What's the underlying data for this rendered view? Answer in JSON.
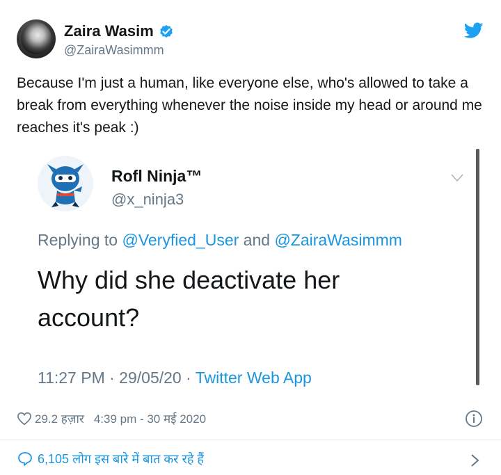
{
  "tweet": {
    "author": {
      "name": "Zaira Wasim",
      "handle": "@ZairaWasimmm"
    },
    "text": "Because I'm just a human, like everyone else, who's allowed to take a break from everything whenever the noise inside my head or around me reaches it's peak :)",
    "likes": "29.2 हज़ार",
    "time": "4:39 pm - 30 मई 2020",
    "conversation": "6,105 लोग इस बारे में बात कर रहे हैं",
    "icons": {
      "verified": "verified-badge-icon",
      "brand": "twitter-bird-icon",
      "like": "heart-icon",
      "info": "info-icon",
      "reply": "speech-bubble-icon",
      "more": "chevron-right-icon"
    },
    "colors": {
      "accent": "#1b95e0",
      "muted": "#657786",
      "text": "#14171a"
    }
  },
  "quoted": {
    "name": "Rofl Ninja™",
    "handle": "@x_ninja3",
    "replying_prefix": "Replying to ",
    "replying_to_1": "@Veryfied_User",
    "replying_and": " and ",
    "replying_to_2": "@ZairaWasimmm",
    "text": "Why did she deactivate her account?",
    "timestamp": "11:27 PM · 29/05/20 · ",
    "source": "Twitter Web App"
  }
}
